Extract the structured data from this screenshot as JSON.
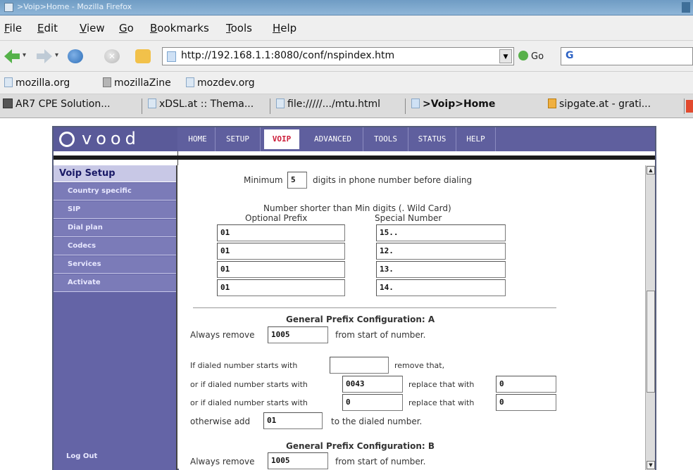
{
  "window": {
    "title": ">Voip>Home - Mozilla Firefox"
  },
  "menu": [
    {
      "label": "File",
      "ul": "F"
    },
    {
      "label": "Edit",
      "ul": "E"
    },
    {
      "label": "View",
      "ul": "V"
    },
    {
      "label": "Go",
      "ul": "G"
    },
    {
      "label": "Bookmarks",
      "ul": "B"
    },
    {
      "label": "Tools",
      "ul": "T"
    },
    {
      "label": "Help",
      "ul": "H"
    }
  ],
  "navbar": {
    "url": "http://192.168.1.1:8080/conf/nspindex.htm",
    "go_label": "Go",
    "search_logo": "G"
  },
  "bookmarks": [
    "mozilla.org",
    "mozillaZine",
    "mozdev.org"
  ],
  "tabs": [
    {
      "label": "AR7 CPE Solution...",
      "active": false
    },
    {
      "label": "xDSL.at :: Thema...",
      "active": false
    },
    {
      "label": "file://///.../mtu.html",
      "active": false
    },
    {
      "label": ">Voip>Home",
      "active": true
    },
    {
      "label": "sipgate.at - grati...",
      "active": false
    }
  ],
  "router": {
    "logo_text": "vood",
    "nav": [
      "HOME",
      "SETUP",
      "VOIP",
      "ADVANCED",
      "TOOLS",
      "STATUS",
      "HELP"
    ],
    "active_nav": "VOIP",
    "sidebar": {
      "title": "Voip Setup",
      "items": [
        "Country specific",
        "SIP",
        "Dial plan",
        "Codecs",
        "Services",
        "Activate"
      ],
      "logout": "Log Out"
    },
    "dialplan": {
      "min_prefix_label": "Minimum",
      "min_digits": "5",
      "min_suffix_label": "digits in phone number before dialing",
      "wildcard_heading": "Number shorter than Min digits (. Wild Card)",
      "col_optional": "Optional Prefix",
      "col_special": "Special Number",
      "rows": [
        {
          "prefix": "01",
          "special": "15.."
        },
        {
          "prefix": "01",
          "special": "12."
        },
        {
          "prefix": "01",
          "special": "13."
        },
        {
          "prefix": "01",
          "special": "14."
        }
      ],
      "section_a": {
        "title": "General Prefix Configuration: A",
        "always_remove_label": "Always remove",
        "always_remove_value": "1005",
        "from_start_label": "from start of number.",
        "starts_with_label": "If dialed number starts with",
        "starts_with_value": "",
        "remove_that_label": "remove that,",
        "or_starts_label_1": "or if dialed number starts with",
        "or_starts_value_1": "0043",
        "replace_label_1": "replace that with",
        "replace_value_1": "0",
        "or_starts_label_2": "or if dialed number starts with",
        "or_starts_value_2": "0",
        "replace_label_2": "replace that with",
        "replace_value_2": "0",
        "otherwise_label": "otherwise add",
        "otherwise_value": "01",
        "to_dialed_label": "to the dialed number."
      },
      "section_b": {
        "title": "General Prefix Configuration: B",
        "always_remove_label": "Always remove",
        "always_remove_value": "1005",
        "from_start_label": "from start of number."
      }
    }
  }
}
